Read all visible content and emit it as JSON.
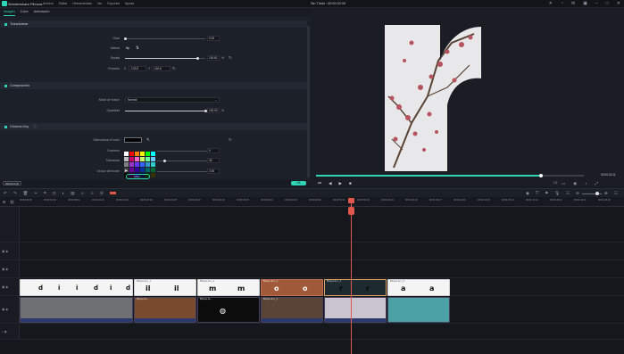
{
  "titlebar": {
    "app_name": "Wondershare Filmora",
    "menu": [
      "Archivo",
      "Editar",
      "Herramientas",
      "Ver",
      "Exportar",
      "Ayuda"
    ],
    "project": "Sin Título : 00:00:22:00"
  },
  "left_panel": {
    "tabs": [
      "Imagen",
      "Color",
      "Animación"
    ],
    "active_tab": "Imagen",
    "transform": {
      "title": "Transformar",
      "rotate_label": "Girar",
      "rotate_value": "0.00",
      "flip_label": "Voltear",
      "scale_label": "Escala",
      "scale_value": "100.61",
      "scale_unit": "%",
      "scale_fraction": 0.9,
      "position_label": "Posición",
      "pos_x_label": "X",
      "pos_x": "-123.5",
      "pos_y_label": "Y",
      "pos_y": "116.6"
    },
    "compositing": {
      "title": "Composición",
      "blend_label": "Modo de fusión",
      "blend_value": "Normal",
      "opacity_label": "Opacidad",
      "opacity_value": "100.00",
      "opacity_unit": "%",
      "opacity_fraction": 1.0
    },
    "chroma": {
      "title": "Chroma Key",
      "select_color_label": "Seleccionar el color",
      "offset_label": "Contorno",
      "offset_value": "0",
      "tolerance_label": "Tolerancia",
      "tolerance_value": "30",
      "edge_label": "Grosor del borde",
      "edge_value": "2.00",
      "more_label": "Más..."
    },
    "reset_button": "REINICIAR",
    "ok_button": "OK"
  },
  "viewer": {
    "timecode": "00:00:22:11",
    "ratio": "1/2",
    "progress_fraction": 0.84
  },
  "ruler": {
    "labels": [
      "00:00:00:00",
      "00:00:04:03",
      "00:00:08:12",
      "00:00:12:21",
      "00:00:16:20",
      "00:00:20:29",
      "00:00:24:28",
      "00:00:28:27",
      "00:00:32:26",
      "00:00:36:25",
      "00:00:40:24",
      "00:00:44:23",
      "00:00:48:22",
      "00:00:52:21",
      "00:00:56:20",
      "00:01:00:19",
      "00:01:04:18",
      "00:01:08:17",
      "00:01:12:16",
      "00:01:16:15",
      "00:01:20:14",
      "00:01:24:13",
      "00:01:28:12",
      "00:01:32:11",
      "00:01:36:10"
    ]
  },
  "timeline": {
    "text_clips": [
      {
        "cap": "",
        "letters": [
          "d",
          "i",
          "i",
          "d",
          "i",
          "d"
        ]
      },
      {
        "cap": "Bloque de t_1",
        "letters": [
          "il",
          "il"
        ]
      },
      {
        "cap": "Bloque de t_2",
        "letters": [
          "m",
          "m"
        ]
      },
      {
        "cap": "Bloque de t_3",
        "letters": [
          "o",
          "o"
        ]
      },
      {
        "cap": "Bloque de t_4",
        "letters": [
          "r",
          "r"
        ]
      },
      {
        "cap": "Bloque de t_5",
        "letters": [
          "a",
          "a"
        ]
      }
    ],
    "video_clips": [
      {
        "cap": "",
        "color": "#6d6f73"
      },
      {
        "cap": "Bloque de...",
        "color": "#7a4a2f"
      },
      {
        "cap": "Bloque de...",
        "color": "#0c0c0c"
      },
      {
        "cap": "Bloque de t_3",
        "color": "#5a4436"
      },
      {
        "cap": "",
        "color": "#c9c4d0"
      },
      {
        "cap": "",
        "color": "#4ba1a6"
      }
    ]
  },
  "colors": {
    "accent": "#2fd3b5",
    "playhead": "#e2574c"
  }
}
